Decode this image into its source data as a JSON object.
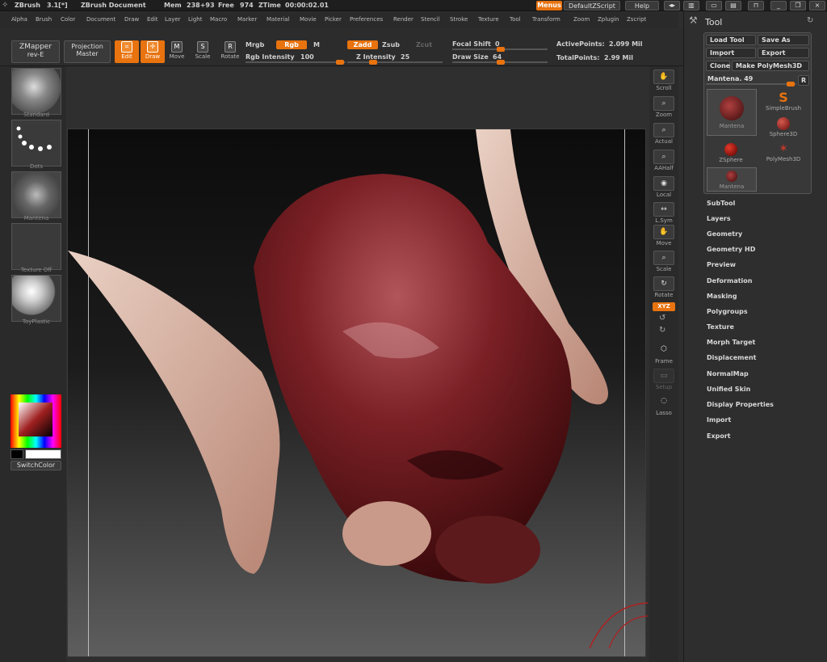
{
  "titlebar": {
    "app": "ZBrush",
    "version": "3.1[*]",
    "document": "ZBrush Document",
    "mem_label": "Mem",
    "mem_value": "238+93",
    "free_label": "Free",
    "free_value": "974",
    "ztime_label": "ZTime",
    "ztime_value": "00:00:02.01",
    "menus_label": "Menus",
    "default_zscript": "DefaultZScript",
    "help": "Help"
  },
  "menubar": [
    "Alpha",
    "Brush",
    "Color",
    "Document",
    "Draw",
    "Edit",
    "Layer",
    "Light",
    "Macro",
    "Marker",
    "Material",
    "Movie",
    "Picker",
    "Preferences",
    "Render",
    "Stencil",
    "Stroke",
    "Texture",
    "Tool",
    "Transform",
    "Zoom",
    "Zplugin",
    "Zscript"
  ],
  "toolbar": {
    "zmapper": "ZMapper",
    "zmapper_sub": "rev-E",
    "projection": "Projection",
    "projection_sub": "Master",
    "edit": "Edit",
    "draw": "Draw",
    "move": "Move",
    "scale": "Scale",
    "rotate": "Rotate",
    "mrgb": "Mrgb",
    "rgb": "Rgb",
    "m": "M",
    "rgb_intensity_label": "Rgb Intensity",
    "rgb_intensity": "100",
    "zadd": "Zadd",
    "zsub": "Zsub",
    "zcut": "Zcut",
    "z_intensity_label": "Z Intensity",
    "z_intensity": "25",
    "focal_shift_label": "Focal Shift",
    "focal_shift": "0",
    "draw_size_label": "Draw Size",
    "draw_size": "64",
    "active_points_label": "ActivePoints:",
    "active_points": "2.099 Mil",
    "total_points_label": "TotalPoints:",
    "total_points": "2.99 Mil"
  },
  "leftshelf": {
    "brush": "Standard",
    "stroke": "Dots",
    "alpha": "Mantena",
    "texture": "Texture Off",
    "material": "ToyPlastic",
    "switch_color": "SwitchColor"
  },
  "rightshelf": [
    "Scroll",
    "Zoom",
    "Actual",
    "AAHalf",
    "Local",
    "L.Sym",
    "Move",
    "Scale",
    "Rotate",
    "Frame",
    "Setup",
    "Lasso"
  ],
  "rightshelf_xyz": "XYZ",
  "toolpalette": {
    "title": "Tool",
    "load_tool": "Load Tool",
    "save_as": "Save As",
    "import": "Import",
    "export": "Export",
    "clone": "Clone",
    "make_polymesh": "Make PolyMesh3D",
    "current_tool": "Mantena. 49",
    "r": "R",
    "tools": [
      "Mantena",
      "SimpleBrush",
      "Sphere3D",
      "ZSphere",
      "PolyMesh3D",
      "Mantena"
    ],
    "sections": [
      "SubTool",
      "Layers",
      "Geometry",
      "Geometry HD",
      "Preview",
      "Deformation",
      "Masking",
      "Polygroups",
      "Texture",
      "Morph Target",
      "Displacement",
      "NormalMap",
      "Unified Skin",
      "Display Properties",
      "Import",
      "Export"
    ]
  },
  "colors": {
    "accent": "#e8730f",
    "flesh": "#6a1417",
    "horn": "#d8a999"
  }
}
